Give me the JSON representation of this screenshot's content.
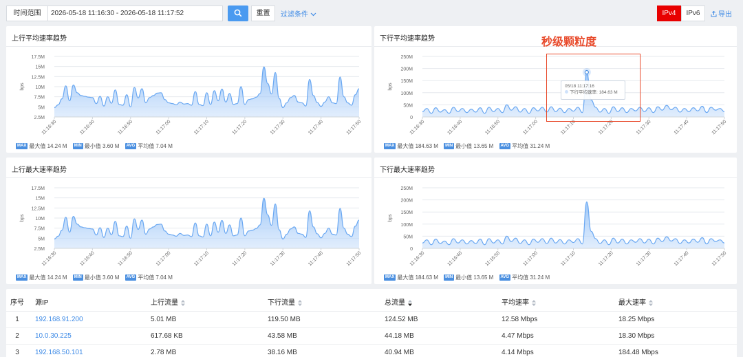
{
  "toolbar": {
    "range_label": "时间范围",
    "range_value": "2026-05-18 11:16:30 - 2026-05-18 11:17:52",
    "reset_label": "重置",
    "filter_label": "过滤条件",
    "ipv4_label": "IPv4",
    "ipv6_label": "IPv6",
    "export_label": "导出"
  },
  "colors": {
    "accent": "#4a9af0",
    "active": "#e80000",
    "annotation": "#e84a2b",
    "line": "#6aa8f2"
  },
  "annotation": {
    "text": "秒级颗粒度"
  },
  "tooltip": {
    "time": "05/18 11:17:16",
    "series": "下行平均速率",
    "value": "184.63 M"
  },
  "panels": [
    {
      "title": "上行平均速率趋势",
      "stats": {
        "max_tag": "MAX",
        "max_label": "最大值 14.24 M",
        "min_tag": "MIN",
        "min_label": "最小值 3.60 M",
        "avg_tag": "AVG",
        "avg_label": "平均值 7.04 M"
      }
    },
    {
      "title": "下行平均速率趋势",
      "stats": {
        "max_tag": "MAX",
        "max_label": "最大值 184.63 M",
        "min_tag": "MIN",
        "min_label": "最小值 13.65 M",
        "avg_tag": "AVG",
        "avg_label": "平均值 31.24 M"
      }
    },
    {
      "title": "上行最大速率趋势",
      "stats": {
        "max_tag": "MAX",
        "max_label": "最大值 14.24 M",
        "min_tag": "MIN",
        "min_label": "最小值 3.60 M",
        "avg_tag": "AVG",
        "avg_label": "平均值 7.04 M"
      }
    },
    {
      "title": "下行最大速率趋势",
      "stats": {
        "max_tag": "MAX",
        "max_label": "最大值 184.63 M",
        "min_tag": "MIN",
        "min_label": "最小值 13.65 M",
        "avg_tag": "AVG",
        "avg_label": "平均值 31.24 M"
      }
    }
  ],
  "chart_data": [
    {
      "type": "area",
      "title": "上行平均速率趋势",
      "ylabel": "bps",
      "yticks": [
        "2.5M",
        "5M",
        "7.5M",
        "10M",
        "12.5M",
        "15M",
        "17.5M"
      ],
      "ylim": [
        2.5,
        17.5
      ],
      "xticks": [
        "11:16:30",
        "11:16:40",
        "11:16:50",
        "11:17:00",
        "11:17:10",
        "11:17:20",
        "11:17:30",
        "11:17:40",
        "11:17:50"
      ],
      "series": [
        {
          "values": [
            4.8,
            5.5,
            7.0,
            10.2,
            6.5,
            10.4,
            8.5,
            7.8,
            7.6,
            7.4,
            7.3,
            5.8,
            7.6,
            5.2,
            7.5,
            5.9,
            9.2,
            5.6,
            5.4,
            8.0,
            5.0,
            9.8,
            7.2,
            9.5,
            6.0,
            7.3,
            7.8,
            8.4,
            8.5,
            6.8,
            6.0,
            5.8,
            5.5,
            6.2,
            5.7,
            5.8,
            5.4,
            8.8,
            5.6,
            5.3,
            8.5,
            5.6,
            9.0,
            6.5,
            9.4,
            6.2,
            8.3,
            5.6,
            5.8,
            10.0,
            5.6,
            6.8,
            7.0,
            7.4,
            8.3,
            14.9,
            10.8,
            8.2,
            13.5,
            7.1,
            4.8,
            6.0,
            7.3,
            7.8,
            6.2,
            6.0,
            5.2,
            11.8,
            7.8,
            6.1,
            5.1,
            6.2,
            7.5,
            6.0,
            5.8,
            12.4,
            7.5,
            6.0,
            5.4,
            8.0,
            9.5
          ]
        }
      ]
    },
    {
      "type": "area",
      "title": "下行平均速率趋势",
      "ylabel": "bps",
      "yticks": [
        "0",
        "50M",
        "100M",
        "150M",
        "200M",
        "250M"
      ],
      "ylim": [
        0,
        250
      ],
      "xticks": [
        "11:16:30",
        "11:16:40",
        "11:16:50",
        "11:17:00",
        "11:17:10",
        "11:17:20",
        "11:17:30",
        "11:17:40",
        "11:17:50"
      ],
      "series": [
        {
          "name": "下行平均速率",
          "values": [
            22,
            35,
            15,
            38,
            20,
            30,
            15,
            40,
            22,
            35,
            18,
            32,
            20,
            38,
            15,
            40,
            22,
            35,
            18,
            50,
            28,
            42,
            20,
            35,
            15,
            38,
            25,
            40,
            20,
            42,
            22,
            36,
            18,
            35,
            24,
            40,
            18,
            184.63,
            70,
            40,
            20,
            35,
            15,
            42,
            22,
            38,
            18,
            35,
            25,
            40,
            22,
            38,
            18,
            42,
            28,
            48,
            30,
            40,
            20,
            35,
            22,
            38,
            25,
            44,
            18,
            40,
            28,
            35,
            22
          ]
        }
      ]
    },
    {
      "type": "area",
      "title": "上行最大速率趋势",
      "ylabel": "bps",
      "yticks": [
        "2.5M",
        "5M",
        "7.5M",
        "10M",
        "12.5M",
        "15M",
        "17.5M"
      ],
      "ylim": [
        2.5,
        17.5
      ],
      "xticks": [
        "11:16:30",
        "11:16:40",
        "11:16:50",
        "11:17:00",
        "11:17:10",
        "11:17:20",
        "11:17:30",
        "11:17:40",
        "11:17:50"
      ],
      "series": [
        {
          "values": [
            4.8,
            5.5,
            7.0,
            10.2,
            6.5,
            10.4,
            8.5,
            7.8,
            7.6,
            7.4,
            7.3,
            5.8,
            7.6,
            5.2,
            7.5,
            5.9,
            9.2,
            5.6,
            5.4,
            8.0,
            5.0,
            9.8,
            7.2,
            9.5,
            6.0,
            7.3,
            7.8,
            8.4,
            8.5,
            6.8,
            6.0,
            5.8,
            5.5,
            6.2,
            5.7,
            5.8,
            5.4,
            8.8,
            5.6,
            5.3,
            8.5,
            5.6,
            9.0,
            6.5,
            9.4,
            6.2,
            8.3,
            5.6,
            5.8,
            10.0,
            5.6,
            6.8,
            7.0,
            7.4,
            8.3,
            14.9,
            10.8,
            8.2,
            13.5,
            7.1,
            4.8,
            6.0,
            7.3,
            7.8,
            6.2,
            6.0,
            5.2,
            11.8,
            7.8,
            6.1,
            5.1,
            6.2,
            7.5,
            6.0,
            5.8,
            12.4,
            7.5,
            6.0,
            5.4,
            8.0,
            9.5
          ]
        }
      ]
    },
    {
      "type": "area",
      "title": "下行最大速率趋势",
      "ylabel": "bps",
      "yticks": [
        "0",
        "50M",
        "100M",
        "150M",
        "200M",
        "250M"
      ],
      "ylim": [
        0,
        250
      ],
      "xticks": [
        "11:16:30",
        "11:16:40",
        "11:16:50",
        "11:17:00",
        "11:17:10",
        "11:17:20",
        "11:17:30",
        "11:17:40",
        "11:17:50"
      ],
      "series": [
        {
          "values": [
            22,
            35,
            15,
            38,
            20,
            30,
            15,
            40,
            22,
            35,
            18,
            32,
            20,
            38,
            15,
            40,
            22,
            35,
            18,
            50,
            28,
            42,
            20,
            35,
            15,
            38,
            25,
            40,
            20,
            42,
            22,
            36,
            18,
            35,
            24,
            40,
            18,
            192,
            70,
            40,
            20,
            35,
            15,
            42,
            22,
            38,
            18,
            35,
            25,
            40,
            22,
            38,
            18,
            42,
            28,
            48,
            30,
            40,
            20,
            35,
            22,
            38,
            25,
            44,
            18,
            40,
            28,
            35,
            22
          ]
        }
      ]
    }
  ],
  "table": {
    "headers": [
      "序号",
      "源IP",
      "上行流量",
      "下行流量",
      "总流量",
      "平均速率",
      "最大速率"
    ],
    "rows": [
      [
        "1",
        "192.168.91.200",
        "5.01 MB",
        "119.50 MB",
        "124.52 MB",
        "12.58 Mbps",
        "18.25 Mbps"
      ],
      [
        "2",
        "10.0.30.225",
        "617.68 KB",
        "43.58 MB",
        "44.18 MB",
        "4.47 Mbps",
        "18.30 Mbps"
      ],
      [
        "3",
        "192.168.50.101",
        "2.78 MB",
        "38.16 MB",
        "40.94 MB",
        "4.14 Mbps",
        "184.48 Mbps"
      ]
    ]
  }
}
